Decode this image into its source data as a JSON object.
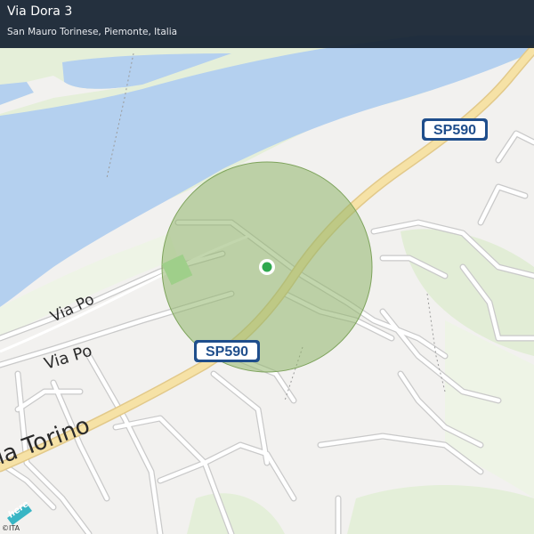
{
  "header": {
    "title": "Via Dora 3",
    "subtitle": "San Mauro Torinese, Piemonte, Italia"
  },
  "map": {
    "road_labels": {
      "via_po_river": "Via Po",
      "via_po": "Via Po",
      "via_torino": "ia Torino"
    },
    "shields": {
      "top": "SP590",
      "center": "SP590"
    },
    "logo": "here",
    "copyright": "©ITA"
  },
  "colors": {
    "water": "#b4d0ef",
    "park": "#e4efd9",
    "accuracy_circle": "#8fb56a",
    "location_dot": "#2fa84f",
    "main_road": "#f6e2a6",
    "header_bg": "#142130"
  }
}
